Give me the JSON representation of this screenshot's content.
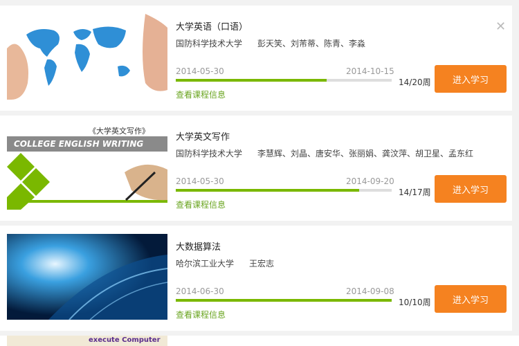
{
  "courses": [
    {
      "title": "大学英语（口语）",
      "university": "国防科学技术大学",
      "teachers": "彭天笑、刘芾蒂、陈青、李淼",
      "start": "2014-05-30",
      "end": "2014-10-15",
      "progress_pct": 70,
      "weeks": "14/20周",
      "info": "查看课程信息",
      "button": "进入学习",
      "close_icon": "close-icon"
    },
    {
      "title": "大学英文写作",
      "university": "国防科学技术大学",
      "teachers": "李慧辉、刘晶、唐安华、张丽娟、龚汶萍、胡卫星、孟东红",
      "start": "2014-05-30",
      "end": "2014-09-20",
      "progress_pct": 85,
      "weeks": "14/17周",
      "info": "查看课程信息",
      "button": "进入学习",
      "thumb_title": "《大学英文写作》",
      "thumb_banner": "COLLEGE ENGLISH WRITING"
    },
    {
      "title": "大数据算法",
      "university": "哈尔滨工业大学",
      "teachers": "王宏志",
      "start": "2014-06-30",
      "end": "2014-09-08",
      "progress_pct": 100,
      "weeks": "10/10周",
      "info": "查看课程信息",
      "button": "进入学习"
    }
  ],
  "partial_text": "execute Computer"
}
